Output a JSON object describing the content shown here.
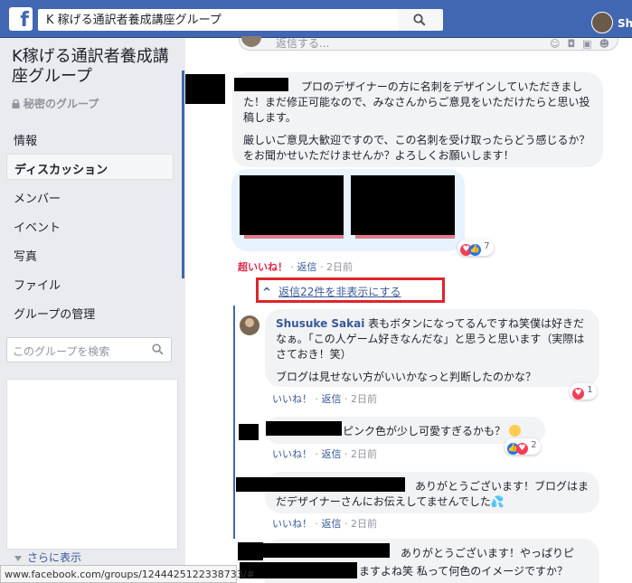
{
  "topbar": {
    "logo": "f",
    "search_value": "K 稼げる通訳者養成講座グループ",
    "user_short": "Sh"
  },
  "sidebar": {
    "group_title": "K稼げる通訳者養成講座グループ",
    "privacy": "秘密のグループ",
    "nav_items": [
      {
        "label": "情報"
      },
      {
        "label": "ディスカッション",
        "active": true
      },
      {
        "label": "メンバー"
      },
      {
        "label": "イベント"
      },
      {
        "label": "写真"
      },
      {
        "label": "ファイル"
      },
      {
        "label": "グループの管理"
      }
    ],
    "search_placeholder": "このグループを検索",
    "more_label": "さらに表示"
  },
  "feed": {
    "reply_placeholder": "返信する...",
    "post": {
      "text_1": "プロのデザイナーの方に名刺をデザインしていただきました！まだ修正可能なので、みなさんからご意見をいただけたらと思い投稿します。",
      "text_2": "厳しいご意見大歓迎ですので、この名刺を受け取ったらどう感じるか？をお聞かせいただけませんか？よろしくお願いします！",
      "reaction_count": "7",
      "reaction_label": "超いいね！",
      "reply_label": "返信",
      "time": "2日前"
    },
    "hide_replies_label": "返信22件を非表示にする",
    "comments": [
      {
        "author": "Shusuke Sakai",
        "text_1": "表もボタンになってるんですね笑僕は好きだなぁ。「この人ゲーム好きなんだな」と思うと思います（実際はさておき！笑）",
        "text_2": "ブログは見せない方がいいかなっと判断したのかな？",
        "like_label": "いいね！",
        "reply_label": "返信",
        "time": "2日前",
        "reaction_count": "1"
      },
      {
        "text": "ピンク色が少し可愛すぎるかも？",
        "like_label": "いいね！",
        "reply_label": "返信",
        "time": "2日前",
        "reaction_count": "2"
      },
      {
        "text": "ありがとうございます！ブログはまだデザイナーさんにお伝えしてませんでした",
        "like_label": "いいね！",
        "reply_label": "返信",
        "time": "2日前"
      },
      {
        "text_1": "ありがとうございます！やっぱりピ",
        "text_2": "ますよね笑 私って何色のイメージですか？"
      }
    ]
  },
  "statusbar": {
    "url": "www.facebook.com/groups/1244425122338733/#"
  },
  "colors": {
    "fb_blue": "#4267b2",
    "link_blue": "#385898",
    "highlight_red": "#e0242b",
    "love_red": "#f33e58"
  }
}
